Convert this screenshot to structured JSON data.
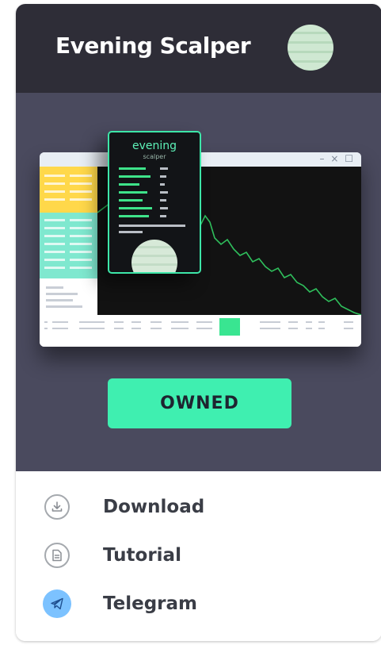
{
  "header": {
    "title": "Evening Scalper"
  },
  "preview": {
    "window_controls": "– × ☐",
    "popup": {
      "title": "evening",
      "subtitle": "scalper"
    }
  },
  "owned_button": {
    "label": "OWNED"
  },
  "links": [
    {
      "label": "Download",
      "icon": "download-icon"
    },
    {
      "label": "Tutorial",
      "icon": "document-icon"
    },
    {
      "label": "Telegram",
      "icon": "telegram-icon"
    }
  ],
  "colors": {
    "header_bg": "#2e2d37",
    "hero_bg": "#4a4a5e",
    "accent": "#3fefb0",
    "telegram": "#7cc2ff"
  }
}
